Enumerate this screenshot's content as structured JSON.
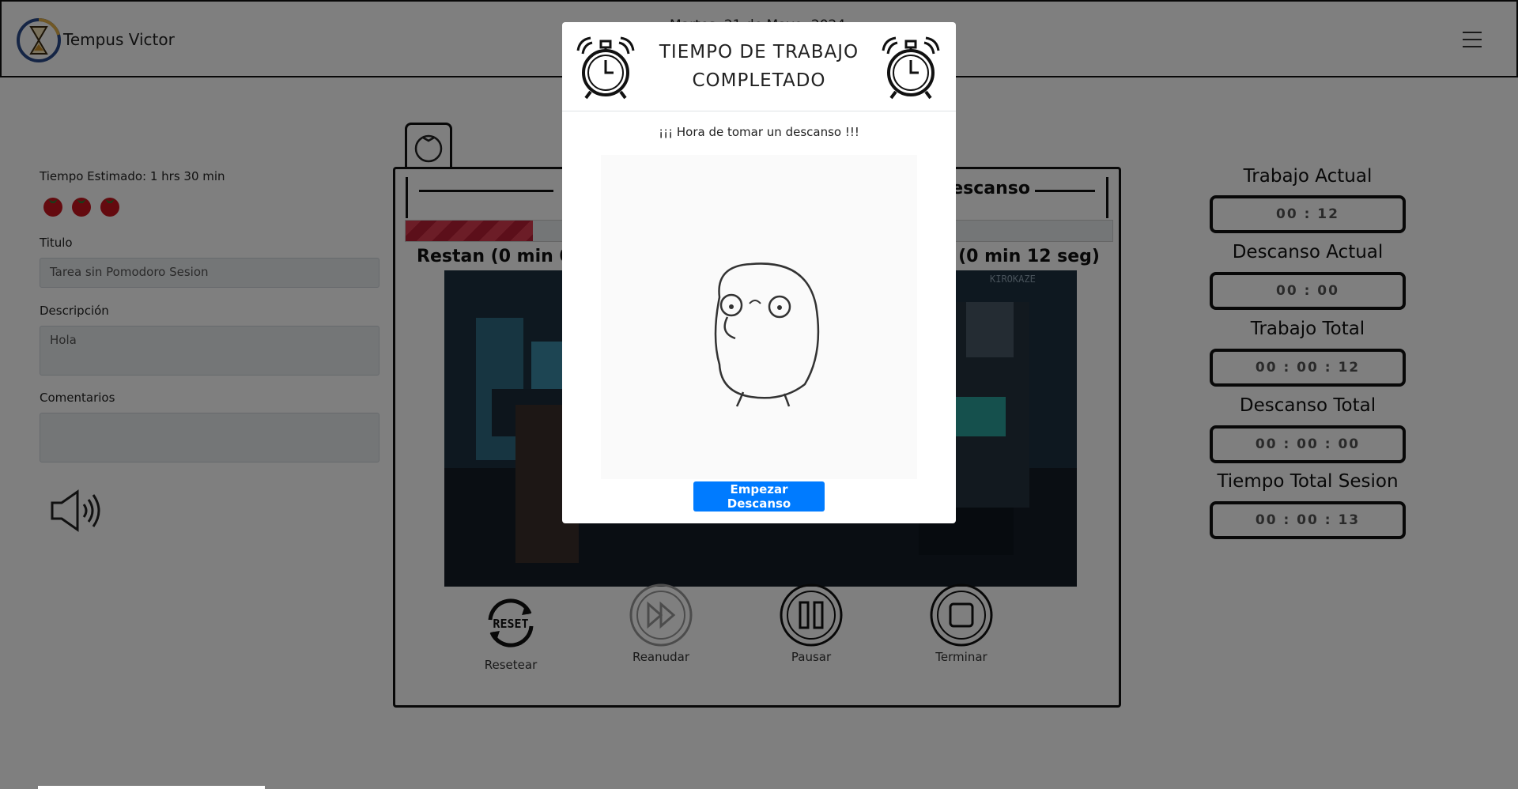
{
  "header": {
    "brand": "Tempus Victor",
    "date": "Martes, 21 de Mayo, 2024",
    "icons": {
      "logo": "hourglass-logo",
      "menu": "hamburger-icon"
    }
  },
  "task": {
    "estimated": "Tiempo Estimado: 1 hrs 30 min",
    "pomodoros": 3,
    "title_label": "Titulo",
    "title_value": "Tarea sin Pomodoro Sesion",
    "description_label": "Descripción",
    "description_value": "Hola",
    "comments_label": "Comentarios",
    "comments_value": ""
  },
  "timer": {
    "mode_label": "Descanso",
    "restan_left": "Restan (0 min 0",
    "restan_right": "n (0 min 12 seg)",
    "progress_fraction": 0.18,
    "scene_watermark": "KIROKAZE",
    "controls": [
      {
        "label": "Resetear",
        "icon": "reset-icon"
      },
      {
        "label": "Reanudar",
        "icon": "fast-forward-icon"
      },
      {
        "label": "Pausar",
        "icon": "pause-icon"
      },
      {
        "label": "Terminar",
        "icon": "stop-icon"
      }
    ]
  },
  "stats": [
    {
      "title": "Trabajo Actual",
      "value": "00 : 12"
    },
    {
      "title": "Descanso Actual",
      "value": "00 : 00"
    },
    {
      "title": "Trabajo Total",
      "value": "00 : 00 : 12"
    },
    {
      "title": "Descanso Total",
      "value": "00 : 00 : 00"
    },
    {
      "title": "Tiempo Total Sesion",
      "value": "00 : 00 : 13"
    }
  ],
  "modal": {
    "title_line1": "TIEMPO DE TRABAJO",
    "title_line2": "COMPLETADO",
    "message": "¡¡¡ Hora de tomar un descanso !!!",
    "button": "Empezar Descanso",
    "button_color": "#007bff"
  },
  "colors": {
    "progress": "#d93a4e",
    "overlay": "rgba(0,0,0,0.5)"
  }
}
